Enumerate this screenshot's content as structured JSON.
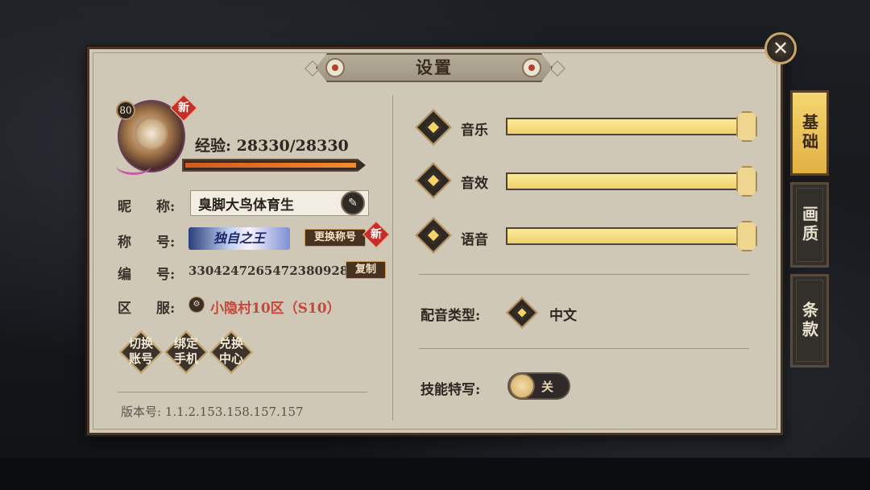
{
  "dialog": {
    "title": "设置",
    "close_symbol": "✕"
  },
  "tabs": [
    {
      "label": "基础",
      "active": true
    },
    {
      "label": "画质",
      "active": false
    },
    {
      "label": "条款",
      "active": false
    }
  ],
  "profile": {
    "level": "80",
    "new_badge": "新",
    "exp_text": "经验: 28330/28330",
    "exp_fraction": 1.0,
    "nickname_label": [
      "昵",
      "称:"
    ],
    "nickname": "臭脚大鸟体育生",
    "title_label": [
      "称",
      "号:"
    ],
    "title_badge": "独自之王",
    "change_title_button": "更换称号",
    "uid_label": [
      "编",
      "号:"
    ],
    "uid": "3304247265472380928",
    "copy_button": "复制",
    "server_label": [
      "区",
      "服:"
    ],
    "server": "小隐村10区（S10）",
    "actions": [
      "切换\n账号",
      "绑定\n手机",
      "兑换\n中心"
    ],
    "version": "版本号: 1.1.2.153.158.157.157"
  },
  "audio": [
    {
      "label": "音乐",
      "level": 1.0
    },
    {
      "label": "音效",
      "level": 1.0
    },
    {
      "label": "语音",
      "level": 1.0
    }
  ],
  "voice_type": {
    "label": "配音类型:",
    "value": "中文"
  },
  "skill_closeup": {
    "label": "技能特写:",
    "state": "关"
  },
  "colors": {
    "accent": "#f4d36a",
    "panel": "#cfc8b7",
    "frame": "#4a3426",
    "server": "#c6473d"
  }
}
